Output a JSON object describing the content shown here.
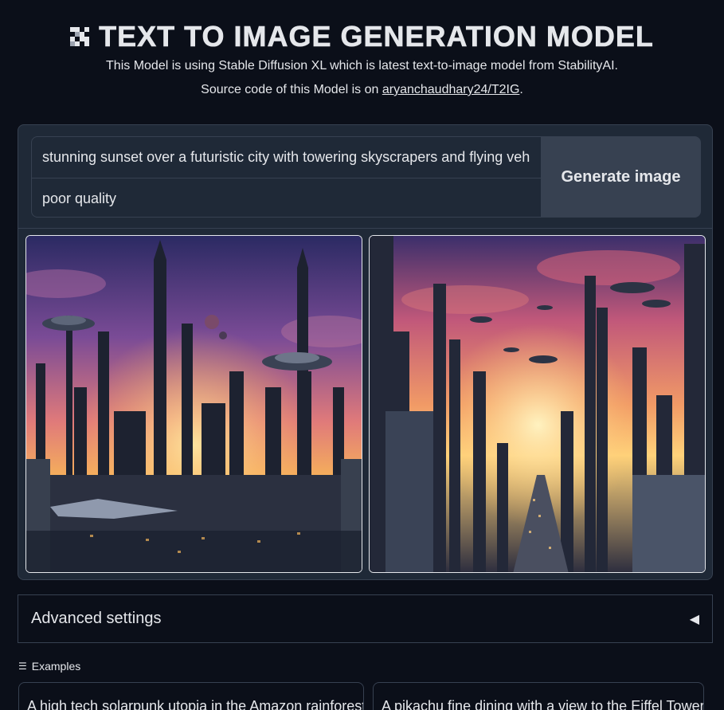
{
  "header": {
    "title": "TEXT TO IMAGE GENERATION MODEL",
    "title_icon": "pixel-grid-icon",
    "subtitle": "This Model is using Stable Diffusion XL which is latest text-to-image model from StabilityAI.",
    "source_prefix": "Source code of this Model is on ",
    "source_link": "aryanchaudhary24/T2IG",
    "source_suffix": "."
  },
  "prompt": {
    "value": "stunning sunset over a futuristic city with towering skyscrapers and flying vehicles",
    "negative_value": "poor quality"
  },
  "generate_button": "Generate image",
  "gallery": {
    "images": [
      {
        "alt": "futuristic city at sunset with saucer towers"
      },
      {
        "alt": "futuristic city at sunset with flying vehicles"
      }
    ]
  },
  "advanced": {
    "label": "Advanced settings",
    "arrow": "◀"
  },
  "examples": {
    "label": "Examples",
    "icon": "list-icon",
    "items": [
      "A high tech solarpunk utopia in the Amazon rainforest",
      "A pikachu fine dining with a view to the Eiffel Tower"
    ]
  },
  "colors": {
    "background": "#0b0f19",
    "panel": "#1f2937",
    "border": "#374151",
    "button": "#374151",
    "text": "#e5e7eb"
  }
}
